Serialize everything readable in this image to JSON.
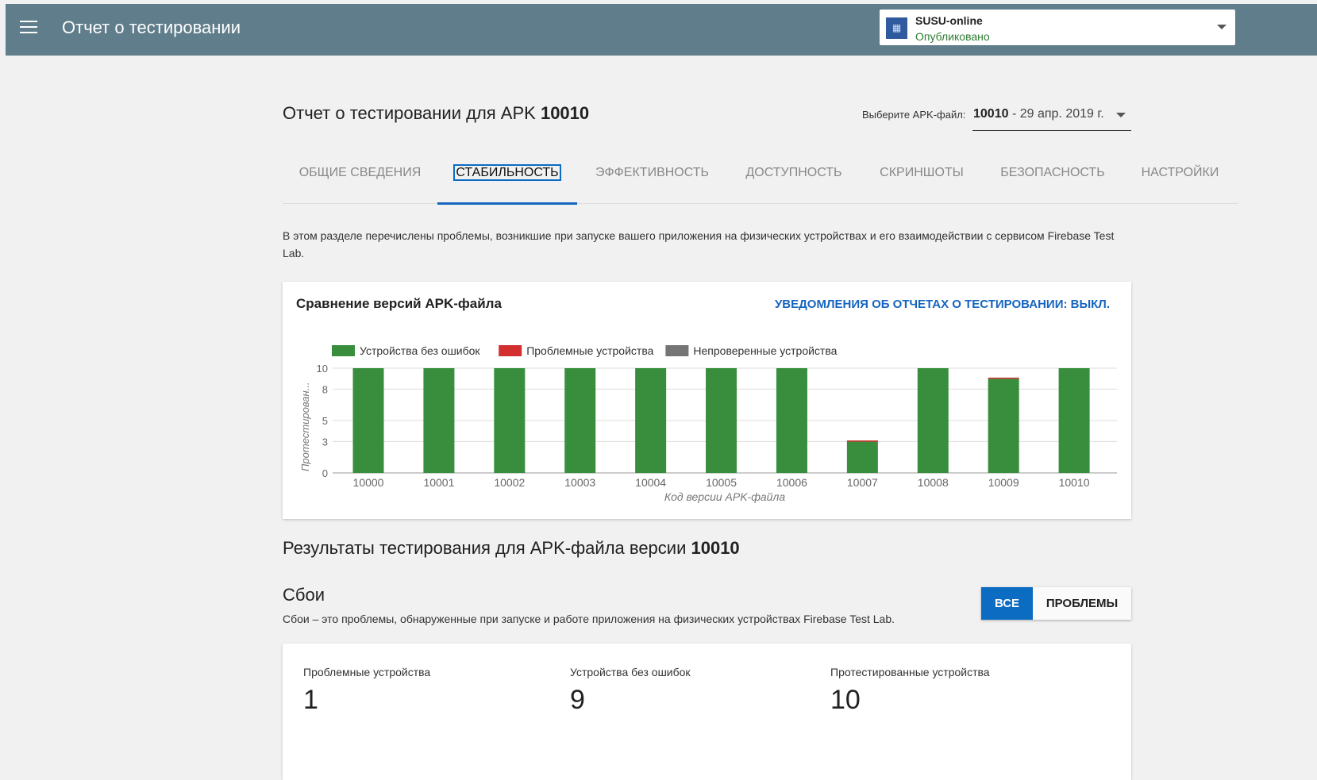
{
  "header": {
    "title": "Отчет о тестировании",
    "app": {
      "name": "SUSU-online",
      "status": "Опубликовано"
    }
  },
  "report": {
    "title_prefix": "Отчет о тестировании для APK ",
    "title_version": "10010",
    "apk_select_label": "Выберите APK-файл:",
    "apk_select_version": "10010",
    "apk_select_date": " - 29 апр. 2019 г."
  },
  "tabs": [
    {
      "label": "Общие сведения"
    },
    {
      "label": "Стабильность"
    },
    {
      "label": "Эффективность"
    },
    {
      "label": "Доступность"
    },
    {
      "label": "Скриншоты"
    },
    {
      "label": "Безопасность"
    },
    {
      "label": "Настройки"
    }
  ],
  "active_tab": "Стабильность",
  "intro": "В этом разделе перечислены проблемы, возникшие при запуске вашего приложения на физических устройствах и его взаимодействии с сервисом Firebase Test Lab.",
  "chart_card": {
    "title": "Сравнение версий APK-файла",
    "notify_link": "Уведомления об отчетах о тестировании: выкл."
  },
  "chart_data": {
    "type": "bar",
    "stacked": true,
    "categories": [
      "10000",
      "10001",
      "10002",
      "10003",
      "10004",
      "10005",
      "10006",
      "10007",
      "10008",
      "10009",
      "10010"
    ],
    "series": [
      {
        "name": "Устройства без ошибок",
        "color": "#388e3c",
        "values": [
          10,
          10,
          10,
          10,
          10,
          10,
          10,
          3,
          10,
          9,
          10
        ]
      },
      {
        "name": "Проблемные устройства",
        "color": "#d32f2f",
        "values": [
          0,
          0,
          0,
          0,
          0,
          0,
          0,
          0.1,
          0,
          0.1,
          0
        ]
      },
      {
        "name": "Непроверенные устройства",
        "color": "#757575",
        "values": [
          0,
          0,
          0,
          0,
          0,
          0,
          0,
          0,
          0,
          0,
          0
        ]
      }
    ],
    "yticks": [
      "0",
      "3",
      "5",
      "8",
      "10"
    ],
    "ylim": [
      0,
      10
    ],
    "xlabel": "Код версии APK-файла",
    "ylabel": "Протестирован...",
    "legend_position": "top",
    "grid": true
  },
  "results": {
    "title_prefix": "Результаты тестирования для APK-файла версии ",
    "title_version": "10010"
  },
  "crashes": {
    "title": "Сбои",
    "description": "Сбои – это проблемы, обнаруженные при запуске и работе приложения на физических устройствах Firebase Test Lab.",
    "toggle_all": "Все",
    "toggle_problems": "Проблемы"
  },
  "stats": [
    {
      "label": "Проблемные устройства",
      "value": "1"
    },
    {
      "label": "Устройства без ошибок",
      "value": "9"
    },
    {
      "label": "Протестированные устройства",
      "value": "10"
    }
  ]
}
